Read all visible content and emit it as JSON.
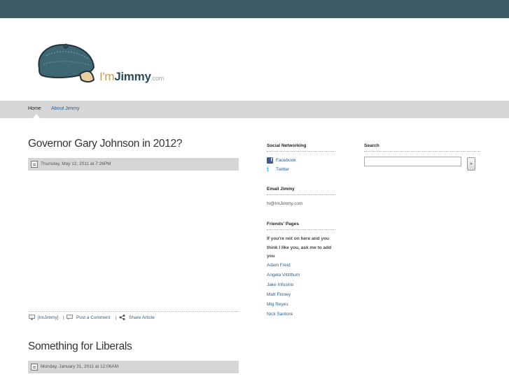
{
  "brand": {
    "im": "I'm",
    "jimmy": "Jimmy",
    "com": ".com"
  },
  "nav": {
    "items": [
      {
        "label": "Home"
      },
      {
        "label": "About Jimmy"
      }
    ]
  },
  "posts": [
    {
      "title": "Governor Gary Johnson in 2012?",
      "date": "Thursday, May 12, 2011 at 7:26PM"
    },
    {
      "title": "Something for Liberals",
      "date": "Monday, January 31, 2011 at 12:06AM"
    }
  ],
  "post_footer": {
    "author": "[ImJimmy]",
    "sep1": "|",
    "comment": "Post a Comment",
    "sep2": "|",
    "share": "Share Article"
  },
  "social": {
    "title": "Social Networking",
    "facebook": "Facebook",
    "twitter": "Twitter"
  },
  "email": {
    "title": "Email Jimmy",
    "address": "hi@ImJimmy.com"
  },
  "friends": {
    "title": "Friends' Pages",
    "note": "If you're not on here and you think I like you, ask me to add you",
    "links": [
      "Adam Freid",
      "Angela Vitzthum",
      "Jake Infusino",
      "Matt Finney",
      "Mig Reyes",
      "Nick Santore"
    ]
  },
  "search": {
    "title": "Search",
    "value": "",
    "button": "»"
  },
  "colors": {
    "topbar": "#3d5c66",
    "navbar": "#d6d6d6",
    "link": "#2c5d8a"
  },
  "icons": {
    "calendar": "calendar-icon",
    "author": "author-icon",
    "comment": "comment-icon",
    "share": "share-icon",
    "facebook": "facebook-icon",
    "twitter": "twitter-icon"
  }
}
